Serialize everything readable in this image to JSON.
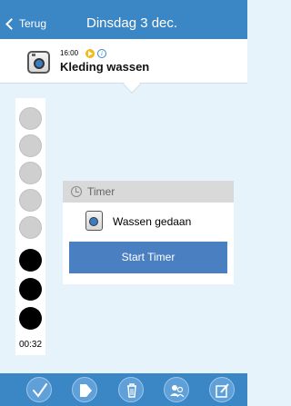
{
  "nav": {
    "back_label": "Terug",
    "title": "Dinsdag 3 dec."
  },
  "activity": {
    "time": "16:00",
    "title": "Kleding wassen",
    "icon": "washing-machine-icon"
  },
  "timer_column": {
    "empty_dots": 5,
    "filled_dots": 3,
    "countdown": "00:32"
  },
  "timer_card": {
    "header": "Timer",
    "message": "Wassen gedaan",
    "button_label": "Start Timer"
  },
  "toolbar": {
    "buttons": [
      "check-icon",
      "tag-icon",
      "trash-icon",
      "people-icon",
      "edit-icon"
    ]
  },
  "colors": {
    "nav": "#3b86c4",
    "accent_button": "#4a7fc2",
    "background": "#e6f3fb",
    "badge_play": "#f2b918"
  }
}
